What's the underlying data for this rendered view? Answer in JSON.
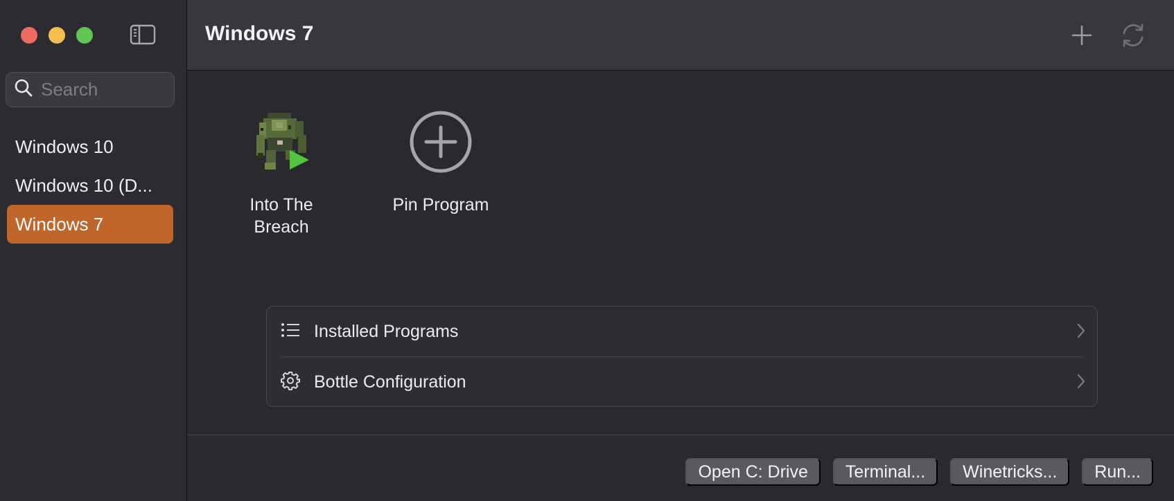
{
  "sidebar": {
    "search_placeholder": "Search",
    "bottles": [
      {
        "label": "Windows 10",
        "selected": false
      },
      {
        "label": "Windows 10 (D...",
        "selected": false
      },
      {
        "label": "Windows 7",
        "selected": true
      }
    ]
  },
  "header": {
    "title": "Windows 7",
    "add_icon": "plus-icon",
    "refresh_icon": "refresh-icon"
  },
  "pinned_programs": [
    {
      "label": "Into The Breach",
      "icon": "game-mech-icon",
      "badge": "play-badge-icon"
    },
    {
      "label": "Pin Program",
      "icon": "plus-circle-icon"
    }
  ],
  "nav_rows": [
    {
      "label": "Installed Programs",
      "icon": "list-icon"
    },
    {
      "label": "Bottle Configuration",
      "icon": "gear-icon"
    }
  ],
  "footer_buttons": [
    {
      "label": "Open C: Drive"
    },
    {
      "label": "Terminal..."
    },
    {
      "label": "Winetricks..."
    },
    {
      "label": "Run..."
    }
  ],
  "colors": {
    "accent": "#c0662a",
    "play_badge": "#52c43f",
    "window_bg": "#2a2a2e",
    "toolbar_bg": "#38383c"
  }
}
